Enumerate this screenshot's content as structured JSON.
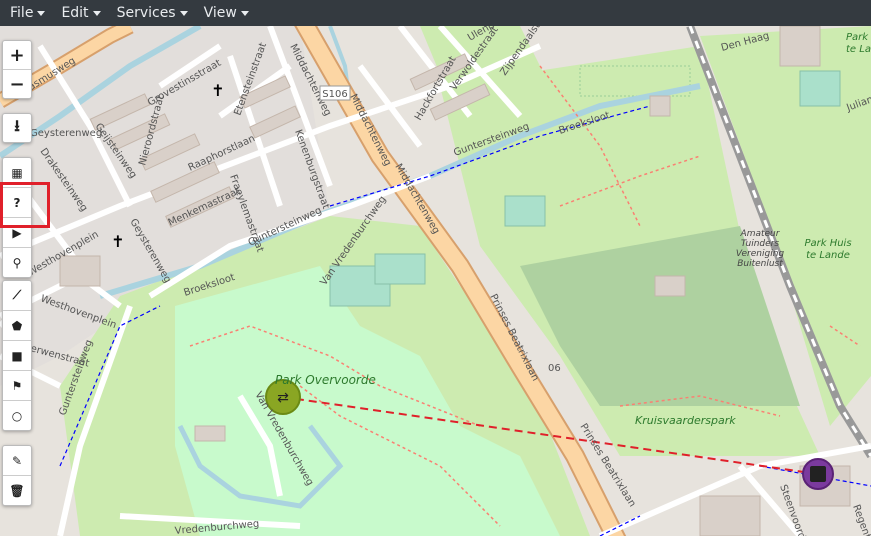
{
  "menu": [
    {
      "label": "File"
    },
    {
      "label": "Edit"
    },
    {
      "label": "Services"
    },
    {
      "label": "View"
    }
  ],
  "toolbar": {
    "zoom_in": "+",
    "zoom_out": "−",
    "help": "?"
  },
  "map_labels": {
    "erasmusweg": "Erasmusweg",
    "groveslaan": "Grovestinsstraat",
    "nieroorde": "Nieroordstraat",
    "etenstein": "Etensteinstraat",
    "middachten": "Middachtenweg",
    "middachten2": "Middachtenweg",
    "middachten3": "Middachtenweg",
    "s106": "S106",
    "s106b": "06",
    "ulenpas": "Ulenpas",
    "zijpendaal": "Zijpendaalstraat",
    "verwolde": "Verwoldestraat",
    "hackfort": "Hackfortstraat",
    "gunterstein1": "Guntersteinweg",
    "gunterstein2": "Guntersteinweg",
    "gunterstein3": "Guntersteinweg",
    "geysterenweg": "Geysterenweg",
    "geysterenweg2": "Geysterenweg",
    "geijsteinweg": "Geijsteinweg",
    "drakestein": "Drakesteinweg",
    "raaphorst": "Raaphorstlaan",
    "menkema": "Menkemastraat",
    "fraeylema": "Fraeylemastraat",
    "kenenburg": "Kenenburgstraat",
    "westhoven": "Westhovenplein",
    "westhoven2": "Westhovenplein",
    "erwen": "erwenstraat",
    "broeksloot": "Broeksloot",
    "broeksloot2": "Broeksloot",
    "vanvredenburch": "Van Vredenburchweg",
    "vanvredenburch2": "Van Vredenburchweg",
    "vredenburchweg": "Vredenburchweg",
    "park_overvoorde": "Park Overvoorde",
    "prinses1": "Prinses Beatrixlaan",
    "prinses2": "Prinses Beatrixlaan",
    "kruisvaarders": "Kruisvaarderspark",
    "amateur1": "Amateur",
    "amateur2": "Tuinders",
    "amateur3": "Vereniging",
    "amateur4": "Buitenlust",
    "parkhuis1": "Park Huis",
    "parkhuis2": "te Lande",
    "parkhuis_tr1": "Park H",
    "parkhuis_tr2": "te Lan",
    "denhaag": "Den Haag",
    "juliana": "Julianala",
    "steenvoorde": "Steenvoorde",
    "regent": "Regent"
  },
  "colors": {
    "menubar": "#343a40",
    "park": "#c8facc",
    "grass": "#cdebb0",
    "route": "#e0202a",
    "highlight": "#e0202a"
  }
}
